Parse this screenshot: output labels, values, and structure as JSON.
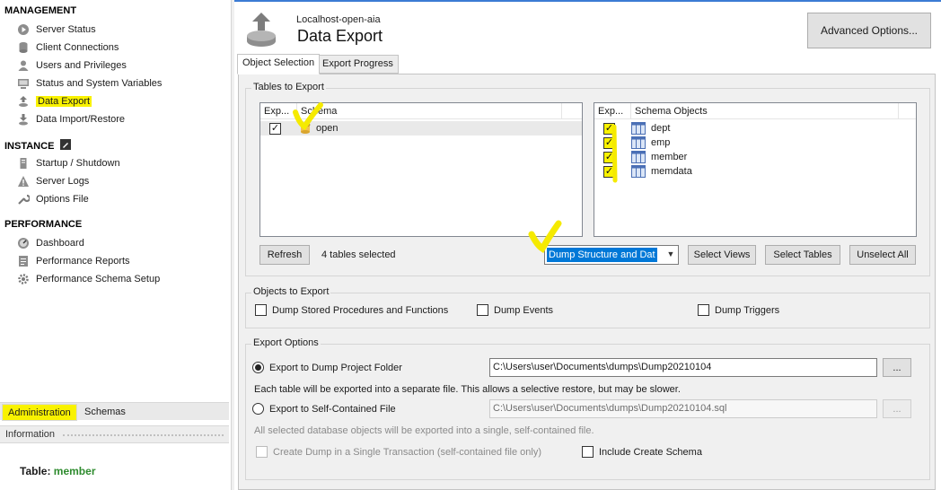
{
  "sidebar": {
    "management": {
      "title": "MANAGEMENT",
      "items": [
        {
          "label": "Server Status",
          "icon": "play-circle-icon"
        },
        {
          "label": "Client Connections",
          "icon": "database-icon"
        },
        {
          "label": "Users and Privileges",
          "icon": "user-icon"
        },
        {
          "label": "Status and System Variables",
          "icon": "monitor-icon"
        },
        {
          "label": "Data Export",
          "icon": "export-icon"
        },
        {
          "label": "Data Import/Restore",
          "icon": "import-icon"
        }
      ]
    },
    "instance": {
      "title": "INSTANCE",
      "items": [
        {
          "label": "Startup / Shutdown",
          "icon": "server-icon"
        },
        {
          "label": "Server Logs",
          "icon": "warning-icon"
        },
        {
          "label": "Options File",
          "icon": "wrench-icon"
        }
      ]
    },
    "performance": {
      "title": "PERFORMANCE",
      "items": [
        {
          "label": "Dashboard",
          "icon": "gauge-icon"
        },
        {
          "label": "Performance Reports",
          "icon": "reports-icon"
        },
        {
          "label": "Performance Schema Setup",
          "icon": "settings-icon"
        }
      ]
    },
    "tabs": {
      "administration": "Administration",
      "schemas": "Schemas"
    },
    "info_label": "Information",
    "table_info": {
      "label": "Table:",
      "value": "member"
    }
  },
  "header": {
    "connection": "Localhost-open-aia",
    "title": "Data Export",
    "advanced_button": "Advanced Options..."
  },
  "tabs": {
    "object_selection": "Object Selection",
    "export_progress": "Export Progress"
  },
  "tables_to_export": {
    "title": "Tables to Export",
    "schema_list": {
      "col_export": "Exp...",
      "col_schema": "Schema",
      "rows": [
        {
          "checked": true,
          "name": "open"
        }
      ]
    },
    "objects_list": {
      "col_export": "Exp...",
      "col_objects": "Schema Objects",
      "rows": [
        {
          "checked": true,
          "name": "dept"
        },
        {
          "checked": true,
          "name": "emp"
        },
        {
          "checked": true,
          "name": "member"
        },
        {
          "checked": true,
          "name": "memdata"
        }
      ]
    },
    "refresh_button": "Refresh",
    "selected_count": "4 tables selected",
    "dump_option": "Dump Structure and Dat",
    "select_views": "Select Views",
    "select_tables": "Select Tables",
    "unselect_all": "Unselect All"
  },
  "objects_to_export": {
    "title": "Objects to Export",
    "dump_routines": "Dump Stored Procedures and Functions",
    "dump_events": "Dump Events",
    "dump_triggers": "Dump Triggers"
  },
  "export_options": {
    "title": "Export Options",
    "project_folder_label": "Export to Dump Project Folder",
    "project_folder_path": "C:\\Users\\user\\Documents\\dumps\\Dump20210104",
    "project_folder_desc": "Each table will be exported into a separate file. This allows a selective restore, but may be slower.",
    "self_contained_label": "Export to Self-Contained File",
    "self_contained_path": "C:\\Users\\user\\Documents\\dumps\\Dump20210104.sql",
    "self_contained_desc": "All selected database objects will be exported into a single, self-contained file.",
    "single_transaction": "Create Dump in a Single Transaction (self-contained file only)",
    "include_create_schema": "Include Create Schema",
    "browse_label": "..."
  }
}
